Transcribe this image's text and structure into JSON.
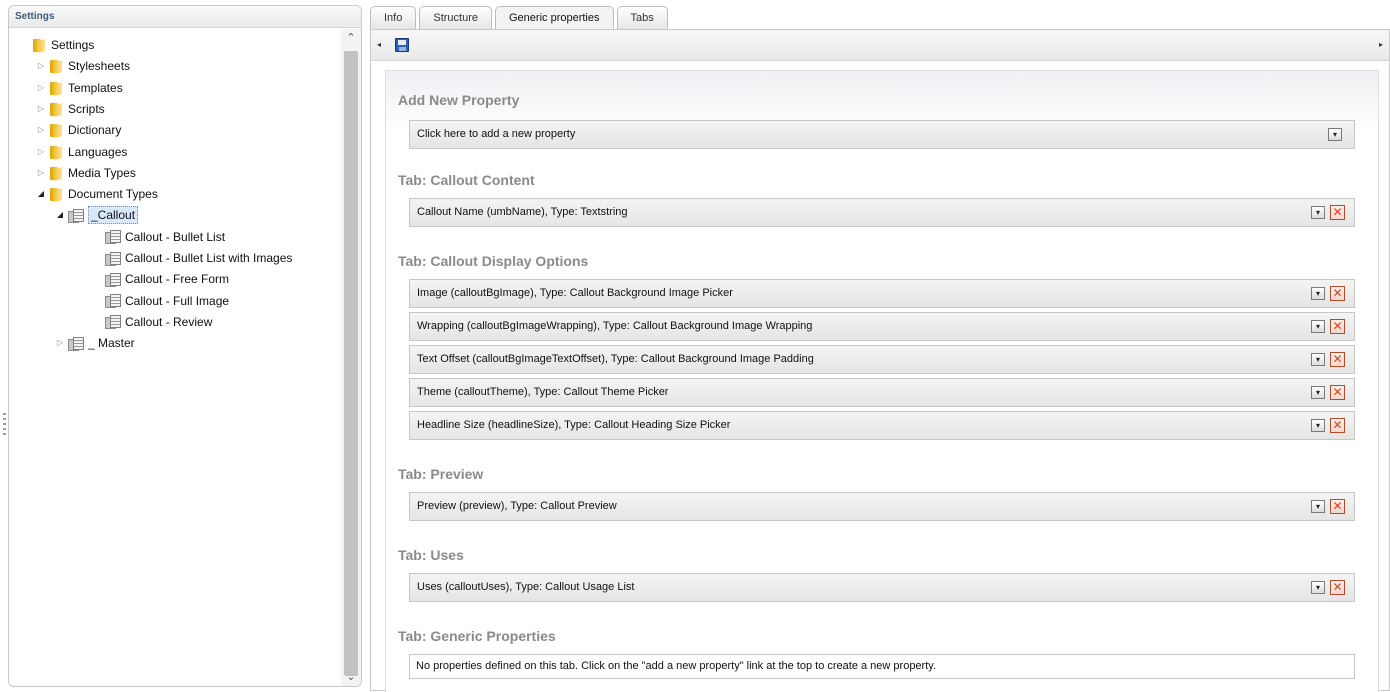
{
  "left_panel": {
    "header": "Settings",
    "tree": [
      {
        "label": "Settings",
        "icon": "folder-icon",
        "arrow": "",
        "selected": false
      },
      {
        "label": "Stylesheets",
        "icon": "folder-icon",
        "arrow": "▷",
        "selected": false
      },
      {
        "label": "Templates",
        "icon": "folder-icon",
        "arrow": "▷",
        "selected": false
      },
      {
        "label": "Scripts",
        "icon": "folder-icon",
        "arrow": "▷",
        "selected": false
      },
      {
        "label": "Dictionary",
        "icon": "folder-icon",
        "arrow": "▷",
        "selected": false
      },
      {
        "label": "Languages",
        "icon": "folder-icon",
        "arrow": "▷",
        "selected": false
      },
      {
        "label": "Media Types",
        "icon": "folder-icon",
        "arrow": "▷",
        "selected": false
      },
      {
        "label": "Document Types",
        "icon": "folder-icon",
        "arrow": "◢",
        "selected": false
      },
      {
        "label": "_Callout",
        "icon": "document-type-icon",
        "arrow": "◢",
        "selected": true
      },
      {
        "label": "Callout - Bullet List",
        "icon": "document-type-icon",
        "arrow": "",
        "selected": false
      },
      {
        "label": "Callout - Bullet List with Images",
        "icon": "document-type-icon",
        "arrow": "",
        "selected": false
      },
      {
        "label": "Callout - Free Form",
        "icon": "document-type-icon",
        "arrow": "",
        "selected": false
      },
      {
        "label": "Callout - Full Image",
        "icon": "document-type-icon",
        "arrow": "",
        "selected": false
      },
      {
        "label": "Callout - Review",
        "icon": "document-type-icon",
        "arrow": "",
        "selected": false
      },
      {
        "label": "_ Master",
        "icon": "document-type-icon",
        "arrow": "▷",
        "selected": false
      }
    ],
    "scroll_up": "⌃",
    "scroll_down": "⌄"
  },
  "tabs": [
    {
      "label": "Info",
      "active": false
    },
    {
      "label": "Structure",
      "active": false
    },
    {
      "label": "Generic properties",
      "active": true
    },
    {
      "label": "Tabs",
      "active": false
    }
  ],
  "toolbar": {
    "left_arrow": "◂",
    "right_arrow": "▸",
    "save_icon": "save-icon"
  },
  "main": {
    "add_new_title": "Add New Property",
    "add_new_link": "Click here to add a new property",
    "expand_glyph": "▾",
    "delete_glyph": "✕",
    "sections": [
      {
        "title": "Tab: Callout Content",
        "properties": [
          "Callout Name (umbName), Type: Textstring"
        ]
      },
      {
        "title": "Tab: Callout Display Options",
        "properties": [
          "Image (calloutBgImage), Type: Callout Background Image Picker",
          "Wrapping (calloutBgImageWrapping), Type: Callout Background Image Wrapping",
          "Text Offset (calloutBgImageTextOffset), Type: Callout Background Image Padding",
          "Theme (calloutTheme), Type: Callout Theme Picker",
          "Headline Size (headlineSize), Type: Callout Heading Size Picker"
        ]
      },
      {
        "title": "Tab: Preview",
        "properties": [
          "Preview (preview), Type: Callout Preview"
        ]
      },
      {
        "title": "Tab: Uses",
        "properties": [
          "Uses (calloutUses), Type: Callout Usage List"
        ]
      },
      {
        "title": "Tab: Generic Properties",
        "properties": []
      }
    ],
    "empty_note": "No properties defined on this tab. Click on the \"add a new property\" link at the top to create a new property."
  },
  "colors": {
    "section_title": "#8a8a8a",
    "header_text": "#3f5a7a",
    "delete_red": "#d8441d",
    "folder": "#f1c232"
  }
}
